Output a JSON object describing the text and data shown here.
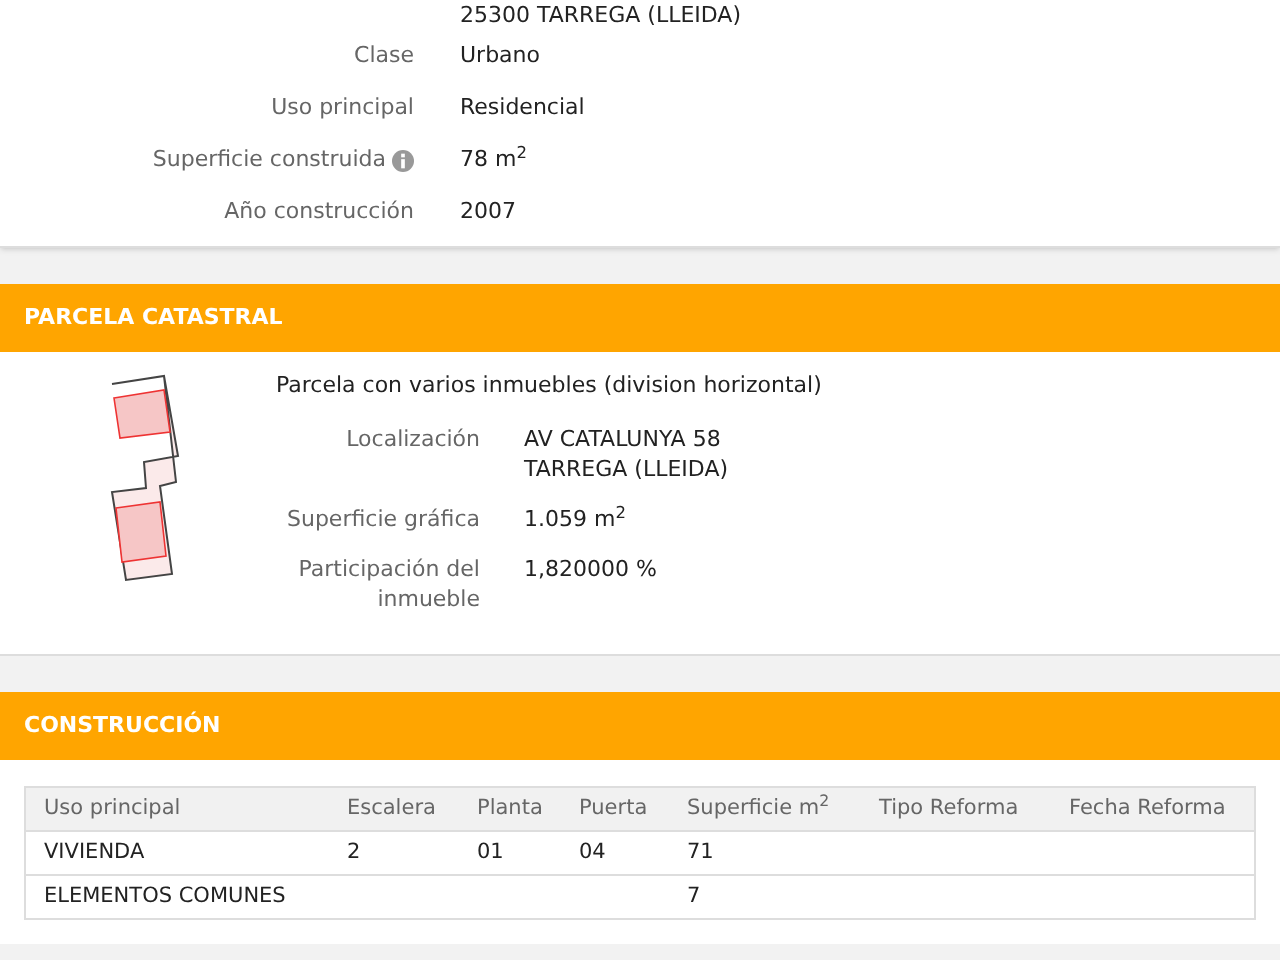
{
  "inmueble": {
    "rows": [
      {
        "value": "25300 TARREGA (LLEIDA)"
      },
      {
        "label": "Clase",
        "value": "Urbano"
      },
      {
        "label": "Uso principal",
        "value": "Residencial"
      },
      {
        "label": "Superficie construida",
        "value": "78 m$^{2}$",
        "info": true
      },
      {
        "label": "Año construcción",
        "value": "2007"
      }
    ]
  },
  "parcela": {
    "title": "PARCELA CATASTRAL",
    "description": "Parcela con varios inmuebles (division horizontal)",
    "rows": [
      {
        "label": "Localización",
        "value_lines": [
          "AV CATALUNYA 58",
          "TARREGA (LLEIDA)"
        ]
      },
      {
        "label": "Superficie gráfica",
        "value_lines": [
          "1.059 m$^{2}$"
        ]
      },
      {
        "label": "Participación del inmueble",
        "value_lines": [
          "1,820000 %"
        ]
      }
    ]
  },
  "construccion": {
    "title": "CONSTRUCCIÓN",
    "table": {
      "columns": [
        "Uso principal",
        "Escalera",
        "Planta",
        "Puerta",
        "Superficie m$^{2}$",
        "Tipo Reforma",
        "Fecha Reforma"
      ],
      "rows": [
        [
          "VIVIENDA",
          "2",
          "01",
          "04",
          "71",
          "",
          ""
        ],
        [
          "ELEMENTOS COMUNES",
          "",
          "",
          "",
          "7",
          "",
          ""
        ]
      ]
    }
  }
}
